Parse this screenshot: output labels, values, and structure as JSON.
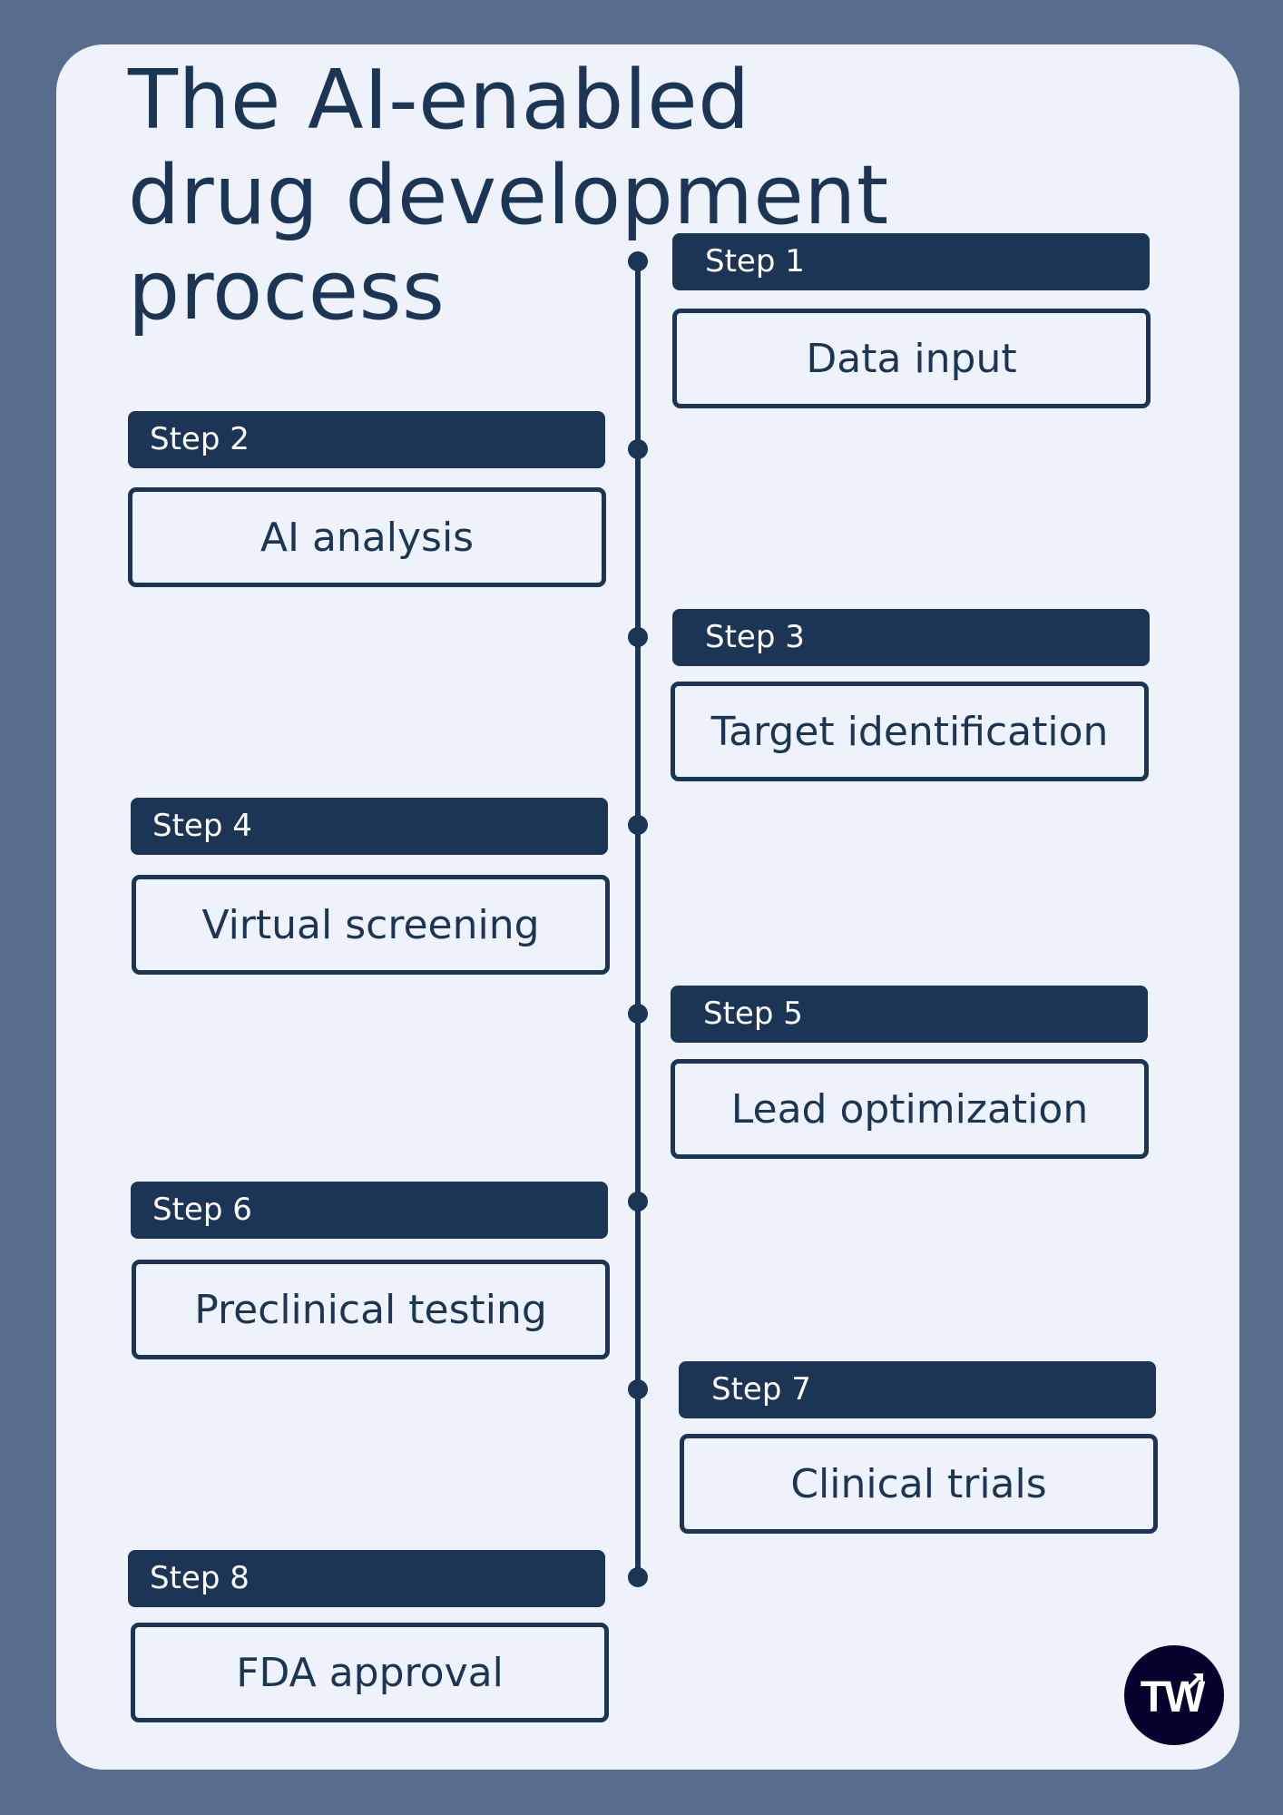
{
  "title": {
    "lines": [
      "The AI-enabled",
      "drug development",
      "process"
    ]
  },
  "colors": {
    "page_background": "#586c8d",
    "card_background": "#eef3fb",
    "primary": "#1c3554",
    "header_text": "#ffffff",
    "logo_background": "#03032d"
  },
  "steps": [
    {
      "label": "Step 1",
      "name": "Data input",
      "side": "right"
    },
    {
      "label": "Step 2",
      "name": "AI analysis",
      "side": "left"
    },
    {
      "label": "Step 3",
      "name": "Target identification",
      "side": "right"
    },
    {
      "label": "Step 4",
      "name": "Virtual screening",
      "side": "left"
    },
    {
      "label": "Step 5",
      "name": "Lead optimization",
      "side": "right"
    },
    {
      "label": "Step 6",
      "name": "Preclinical testing",
      "side": "left"
    },
    {
      "label": "Step 7",
      "name": "Clinical trials",
      "side": "right"
    },
    {
      "label": "Step 8",
      "name": "FDA approval",
      "side": "left"
    }
  ],
  "logo": {
    "text": "TW",
    "icon": "arrow-up-right-icon"
  }
}
